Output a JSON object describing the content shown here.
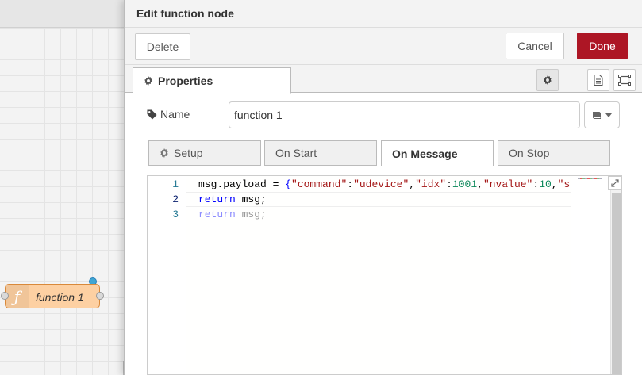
{
  "tray": {
    "title": "Edit function node",
    "buttons": {
      "delete": "Delete",
      "cancel": "Cancel",
      "done": "Done"
    },
    "tabs": {
      "properties": "Properties"
    },
    "tab_icons": [
      "gear-icon",
      "description-icon",
      "appearance-icon"
    ]
  },
  "form": {
    "name_label": "Name",
    "name_value": "function 1",
    "name_icon": "tag-icon",
    "icon_picker": "book-icon"
  },
  "function_tabs": [
    "Setup",
    "On Start",
    "On Message",
    "On Stop"
  ],
  "editor": {
    "line_numbers": [
      "1",
      "2",
      "3"
    ],
    "line1": {
      "kw": "msg.payload = ",
      "open": "{",
      "s1": "\"command\"",
      "c1": ":",
      "s2": "\"udevice\"",
      "c2": ",",
      "s3": "\"idx\"",
      "c3": ":",
      "n1": "1001",
      "c4": ",",
      "s4": "\"nvalue\"",
      "c5": ":",
      "n2": "10",
      "c6": ",",
      "s5": "\"sv"
    },
    "line2": {
      "kw": "return",
      "rest": " msg;"
    },
    "line3": {
      "kw": "return",
      "rest": " msg;"
    }
  },
  "workspace": {
    "node_label": "function 1",
    "node_icon": "function-icon"
  },
  "colors": {
    "done_button": "#ad1625",
    "node_fill": "#fdd0a2",
    "changed_indicator": "#40a6d3"
  }
}
